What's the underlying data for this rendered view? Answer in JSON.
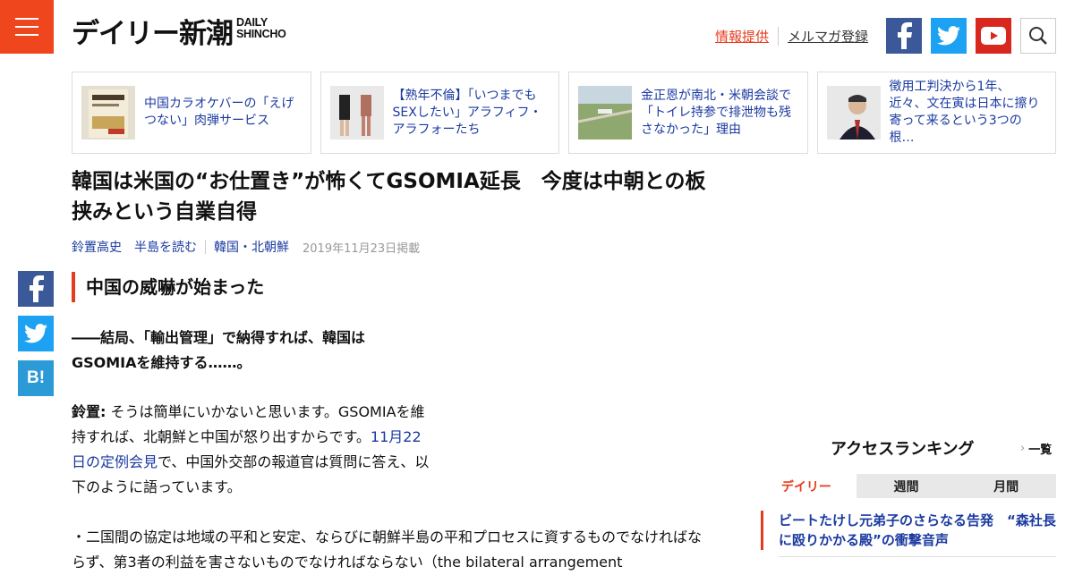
{
  "header": {
    "logo_main": "デイリー新潮",
    "logo_sub_1": "DAILY",
    "logo_sub_2": "SHINCHO",
    "link_info": "情報提供",
    "link_mail": "メルマガ登録"
  },
  "related": [
    {
      "text": "中国カラオケバーの「えげつない」肉弾サービス",
      "thumb": "book-cover"
    },
    {
      "text": "【熟年不倫】「いつまでもSEXしたい」アラフィフ・アラフォーたち",
      "thumb": "people-photo"
    },
    {
      "text": "金正恩が南北・米朝会談で「トイレ持参で排泄物も残さなかった」理由",
      "thumb": "landscape-photo"
    },
    {
      "text": "徴用工判決から1年、近々、文在寅は日本に擦り寄って来るという3つの根…",
      "thumb": "portrait-photo"
    }
  ],
  "article": {
    "title": "韓国は米国の“お仕置き”が怖くてGSOMIA延長　今度は中朝との板挟みという自業自得",
    "author": "鈴置高史",
    "series": "半島を読む",
    "category": "韓国・北朝鮮",
    "date": "2019年11月23日掲載",
    "section_heading": "中国の威嚇が始まった",
    "question": "――結局、「輸出管理」で納得すれば、韓国はGSOMIAを維持する……。",
    "speaker": "鈴置:",
    "answer_1": " そうは簡単にいかないと思います。GSOMIAを維持すれば、北朝鮮と中国が怒り出すからです。",
    "answer_link": "11月22日の定例会見",
    "answer_2": "で、中国外交部の報道官は質問に答え、以下のように語っています。",
    "quote": "・二国間の協定は地域の平和と安定、ならびに朝鮮半島の平和プロセスに資するものでなければならず、第3者の利益を害さないものでなければならない（the bilateral arrangement"
  },
  "share": {
    "hatena": "B!"
  },
  "ranking": {
    "title": "アクセスランキング",
    "all": "一覧",
    "tabs": [
      "デイリー",
      "週間",
      "月間"
    ],
    "active_tab": 0,
    "first_item": "ビートたけし元弟子のさらなる告発　“森社長に殴りかかる殿”の衝撃音声"
  },
  "colors": {
    "accent": "#e63c1e",
    "link": "#1a3aa0",
    "facebook": "#3b5998",
    "twitter": "#1da1f2",
    "youtube": "#d8281d",
    "hatena": "#2c9ad6"
  }
}
